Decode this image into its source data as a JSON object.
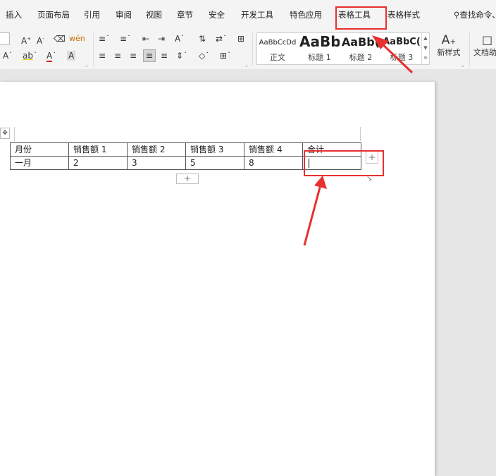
{
  "menu": {
    "items": [
      "插入",
      "页面布局",
      "引用",
      "审阅",
      "视图",
      "章节",
      "安全",
      "开发工具",
      "特色应用",
      "表格工具",
      "表格样式"
    ],
    "search_label": "查找命令、"
  },
  "ribbon": {
    "styles": [
      {
        "preview": "AaBbCcDd",
        "name": "正文"
      },
      {
        "preview": "AaBb",
        "name": "标题 1"
      },
      {
        "preview": "AaBb(",
        "name": "标题 2"
      },
      {
        "preview": "AaBbC(",
        "name": "标题 3"
      }
    ],
    "new_style_label": "新样式",
    "doc_label": "文档助"
  },
  "table": {
    "headers": [
      "月份",
      "销售额 1",
      "销售额 2",
      "销售额 3",
      "销售额 4",
      "合计"
    ],
    "rows": [
      [
        "一月",
        "2",
        "3",
        "5",
        "8",
        ""
      ]
    ]
  },
  "colors": {
    "annotation": "#e8302f",
    "accent": "#7a8cf0"
  }
}
